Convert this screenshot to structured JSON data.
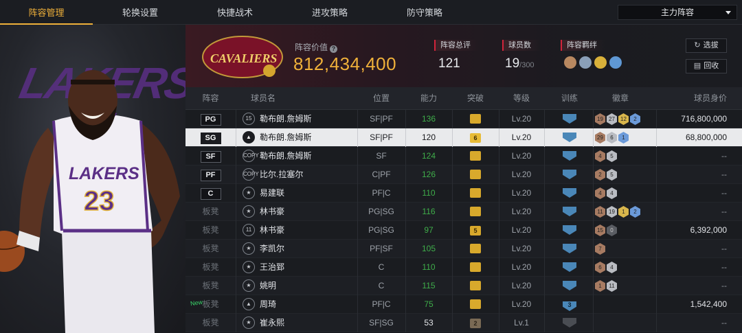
{
  "nav": {
    "tabs": [
      "阵容管理",
      "轮换设置",
      "快捷战术",
      "进攻策略",
      "防守策略"
    ],
    "active_tab": 0,
    "lineup_select": "主力阵容"
  },
  "header": {
    "team_logo_text": "CAVALIERS",
    "value_label": "阵容价值",
    "value": "812,434,400",
    "rating_label": "阵容总评",
    "rating": "121",
    "players_label": "球员数",
    "players_count": "19",
    "players_max": "/300",
    "synergy_label": "阵容羁绊",
    "buttons": {
      "select": "选拔",
      "recycle": "回收"
    }
  },
  "hero": {
    "jersey_number": "23",
    "team_word": "LAKERS"
  },
  "table": {
    "columns": [
      "阵容",
      "球员名",
      "位置",
      "能力",
      "突破",
      "等级",
      "训练",
      "徽章",
      "球员身价"
    ],
    "rows": [
      {
        "slot": "PG",
        "starter": true,
        "icon": "15",
        "name": "勒布朗.詹姆斯",
        "pos": "SF|PF",
        "ability": "136",
        "ab": "green",
        "breakthrough": "",
        "level": "Lv.20",
        "train": "",
        "badges": [
          [
            "bronze",
            "19"
          ],
          [
            "silver",
            "27"
          ],
          [
            "gold",
            "12"
          ],
          [
            "blue",
            "2"
          ]
        ],
        "price": "716,800,000"
      },
      {
        "slot": "SG",
        "starter": true,
        "selected": true,
        "icon": "▲",
        "name": "勒布朗.詹姆斯",
        "pos": "SF|PF",
        "ability": "120",
        "ab": "white",
        "breakthrough": "6",
        "level": "Lv.20",
        "train": "",
        "badges": [
          [
            "bronze",
            "29"
          ],
          [
            "silver",
            "6"
          ],
          [
            "blue",
            "1"
          ]
        ],
        "price": "68,800,000"
      },
      {
        "slot": "SF",
        "starter": true,
        "icon": "COPY",
        "name": "勒布朗.詹姆斯",
        "pos": "SF",
        "ability": "124",
        "ab": "green",
        "breakthrough": "",
        "level": "Lv.20",
        "train": "",
        "badges": [
          [
            "bronze",
            "4"
          ],
          [
            "silver",
            "5"
          ]
        ],
        "price": "--"
      },
      {
        "slot": "PF",
        "starter": true,
        "icon": "COPY",
        "name": "比尔.拉塞尔",
        "pos": "C|PF",
        "ability": "126",
        "ab": "green",
        "breakthrough": "",
        "level": "Lv.20",
        "train": "",
        "badges": [
          [
            "bronze",
            "2"
          ],
          [
            "silver",
            "5"
          ]
        ],
        "price": "--"
      },
      {
        "slot": "C",
        "starter": true,
        "icon": "★",
        "name": "易建联",
        "pos": "PF|C",
        "ability": "110",
        "ab": "green",
        "breakthrough": "",
        "level": "Lv.20",
        "train": "",
        "badges": [
          [
            "bronze",
            "4"
          ],
          [
            "silver",
            "4"
          ]
        ],
        "price": "--"
      },
      {
        "slot": "板凳",
        "starter": false,
        "icon": "★",
        "name": "林书豪",
        "pos": "PG|SG",
        "ability": "116",
        "ab": "green",
        "breakthrough": "",
        "level": "Lv.20",
        "train": "",
        "badges": [
          [
            "bronze",
            "11"
          ],
          [
            "silver",
            "19"
          ],
          [
            "gold",
            "1"
          ],
          [
            "blue",
            "2"
          ]
        ],
        "price": "--"
      },
      {
        "slot": "板凳",
        "starter": false,
        "icon": "11",
        "name": "林书豪",
        "pos": "PG|SG",
        "ability": "97",
        "ab": "green",
        "breakthrough": "5",
        "level": "Lv.20",
        "train": "",
        "badges": [
          [
            "bronze",
            "15"
          ],
          [
            "dark",
            "0"
          ]
        ],
        "price": "6,392,000"
      },
      {
        "slot": "板凳",
        "starter": false,
        "icon": "★",
        "name": "李凯尔",
        "pos": "PF|SF",
        "ability": "105",
        "ab": "green",
        "breakthrough": "",
        "level": "Lv.20",
        "train": "",
        "badges": [
          [
            "bronze",
            "7"
          ]
        ],
        "price": "--"
      },
      {
        "slot": "板凳",
        "starter": false,
        "icon": "★",
        "name": "王治郅",
        "pos": "C",
        "ability": "110",
        "ab": "green",
        "breakthrough": "",
        "level": "Lv.20",
        "train": "",
        "badges": [
          [
            "bronze",
            "6"
          ],
          [
            "silver",
            "4"
          ]
        ],
        "price": "--"
      },
      {
        "slot": "板凳",
        "starter": false,
        "icon": "★",
        "name": "姚明",
        "pos": "C",
        "ability": "115",
        "ab": "green",
        "breakthrough": "",
        "level": "Lv.20",
        "train": "",
        "badges": [
          [
            "bronze",
            "1"
          ],
          [
            "silver",
            "11"
          ]
        ],
        "price": "--"
      },
      {
        "slot": "板凳",
        "starter": false,
        "new": "New",
        "icon": "▲",
        "name": "周琦",
        "pos": "PF|C",
        "ability": "75",
        "ab": "green",
        "breakthrough": "",
        "level": "Lv.20",
        "train": "3",
        "badges": [],
        "price": "1,542,400"
      },
      {
        "slot": "板凳",
        "starter": false,
        "icon": "★",
        "name": "崔永熙",
        "pos": "SF|SG",
        "ability": "53",
        "ab": "white",
        "breakthrough": "2",
        "level": "Lv.1",
        "train": "dim",
        "badges": [],
        "price": "--"
      }
    ]
  }
}
